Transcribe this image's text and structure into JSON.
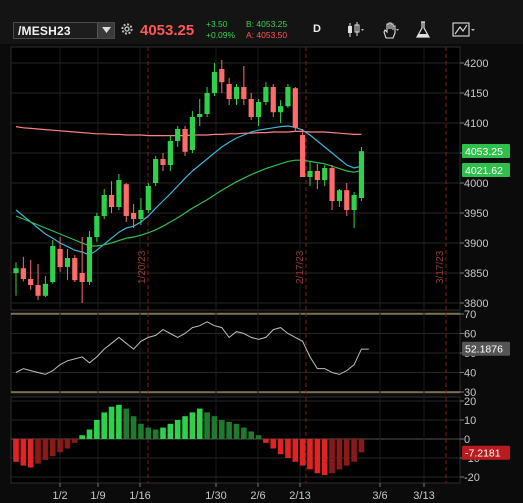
{
  "toolbar": {
    "symbol": "/MESH23",
    "last_price": "4053.25",
    "net_change": "+3.50",
    "pct_change": "+0.09%",
    "bid": "B: 4053.25",
    "ask": "A: 4053.50",
    "aggregation": "D",
    "icons": [
      "gear-icon",
      "candles-icon",
      "hand-icon",
      "flask-icon",
      "drawing-tools-icon"
    ]
  },
  "chart_data": [
    {
      "type": "candlestick",
      "ylim": [
        3790,
        4205
      ],
      "y_ticks": [
        "4200",
        "4150",
        "4100",
        "4050",
        "4000",
        "3950",
        "3900",
        "3850",
        "3800"
      ],
      "x_ticks": [
        "1/2",
        "1/9",
        "1/16",
        "1/30",
        "2/6",
        "2/13",
        "3/6",
        "3/13"
      ],
      "expiration_markers": [
        "1/20/23",
        "2/17/23",
        "3/17/23"
      ],
      "price_labels": [
        {
          "text": "4053.25",
          "color": "#2fbf4b"
        },
        {
          "text": "4021.62",
          "color": "#2fbf4b"
        }
      ],
      "candles": [
        [
          3850,
          3868,
          3812,
          3858
        ],
        [
          3858,
          3877,
          3836,
          3840
        ],
        [
          3840,
          3872,
          3822,
          3830
        ],
        [
          3830,
          3865,
          3805,
          3812
        ],
        [
          3812,
          3845,
          3810,
          3832
        ],
        [
          3835,
          3905,
          3832,
          3895
        ],
        [
          3890,
          3910,
          3852,
          3860
        ],
        [
          3860,
          3890,
          3838,
          3875
        ],
        [
          3875,
          3880,
          3835,
          3838
        ],
        [
          3850,
          3910,
          3800,
          3835
        ],
        [
          3835,
          3920,
          3830,
          3910
        ],
        [
          3910,
          3950,
          3902,
          3945
        ],
        [
          3945,
          3990,
          3940,
          3980
        ],
        [
          3980,
          4003,
          3950,
          3960
        ],
        [
          3960,
          4015,
          3955,
          4005
        ],
        [
          3998,
          4000,
          3935,
          3945
        ],
        [
          3950,
          3965,
          3925,
          3940
        ],
        [
          3940,
          3975,
          3930,
          3955
        ],
        [
          3955,
          4000,
          3950,
          3995
        ],
        [
          4000,
          4045,
          3995,
          4040
        ],
        [
          4040,
          4050,
          4020,
          4030
        ],
        [
          4030,
          4080,
          4020,
          4070
        ],
        [
          4070,
          4095,
          4060,
          4090
        ],
        [
          4090,
          4095,
          4045,
          4052
        ],
        [
          4055,
          4120,
          4050,
          4110
        ],
        [
          4110,
          4140,
          4095,
          4115
        ],
        [
          4115,
          4160,
          4110,
          4150
        ],
        [
          4150,
          4200,
          4145,
          4185
        ],
        [
          4190,
          4205,
          4150,
          4168
        ],
        [
          4165,
          4175,
          4130,
          4140
        ],
        [
          4140,
          4165,
          4130,
          4160
        ],
        [
          4160,
          4195,
          4130,
          4140
        ],
        [
          4140,
          4150,
          4105,
          4110
        ],
        [
          4110,
          4140,
          4095,
          4135
        ],
        [
          4135,
          4168,
          4130,
          4160
        ],
        [
          4160,
          4165,
          4110,
          4118
        ],
        [
          4118,
          4138,
          4100,
          4128
        ],
        [
          4128,
          4165,
          4125,
          4160
        ],
        [
          4158,
          4160,
          4085,
          4092
        ],
        [
          4080,
          4090,
          4010,
          4010
        ],
        [
          4010,
          4035,
          3995,
          4020
        ],
        [
          4020,
          4032,
          3990,
          4005
        ],
        [
          4005,
          4030,
          3995,
          4025
        ],
        [
          4025,
          4030,
          3955,
          3970
        ],
        [
          3970,
          3990,
          3960,
          3988
        ],
        [
          3988,
          4000,
          3945,
          3955
        ],
        [
          3955,
          3985,
          3925,
          3980
        ],
        [
          3975,
          4060,
          3970,
          4053
        ]
      ],
      "moving_averages": [
        {
          "name": "",
          "color": "#ff8080",
          "values": [
            4094,
            4092,
            4091,
            4090,
            4089,
            4088,
            4087,
            4086,
            4085,
            4084,
            4083,
            4082,
            4082,
            4081,
            4081,
            4080,
            4080,
            4080,
            4079,
            4079,
            4079,
            4079,
            4079,
            4079,
            4080,
            4080,
            4080,
            4081,
            4081,
            4082,
            4082,
            4083,
            4083,
            4084,
            4084,
            4085,
            4085,
            4085,
            4086,
            4086,
            4085,
            4085,
            4085,
            4084,
            4083,
            4082,
            4081,
            4081
          ]
        },
        {
          "name": "",
          "color": "#3fb6d8",
          "values": [
            3955,
            3945,
            3935,
            3925,
            3915,
            3908,
            3900,
            3894,
            3888,
            3885,
            3880,
            3888,
            3898,
            3908,
            3918,
            3925,
            3928,
            3935,
            3945,
            3958,
            3970,
            3982,
            3995,
            4008,
            4020,
            4030,
            4040,
            4050,
            4060,
            4068,
            4075,
            4080,
            4085,
            4088,
            4090,
            4092,
            4094,
            4095,
            4093,
            4088,
            4080,
            4070,
            4060,
            4050,
            4040,
            4030,
            4025,
            4028
          ]
        },
        {
          "name": "",
          "color": "#2fbf4b",
          "values": [
            3945,
            3940,
            3935,
            3930,
            3925,
            3920,
            3915,
            3910,
            3905,
            3900,
            3895,
            3895,
            3897,
            3900,
            3904,
            3908,
            3910,
            3913,
            3917,
            3922,
            3928,
            3935,
            3942,
            3950,
            3958,
            3965,
            3972,
            3980,
            3988,
            3995,
            4002,
            4008,
            4014,
            4019,
            4024,
            4028,
            4032,
            4036,
            4038,
            4038,
            4036,
            4034,
            4032,
            4028,
            4024,
            4020,
            4018,
            4021
          ]
        }
      ]
    },
    {
      "type": "line",
      "ylim": [
        30,
        70
      ],
      "y_ticks": [
        "70",
        "60",
        "50",
        "40",
        "30"
      ],
      "last_label": "52.1876",
      "values": [
        40,
        42,
        41,
        40,
        39,
        41,
        44,
        46,
        47,
        48,
        45,
        48,
        52,
        55,
        58,
        55,
        52,
        56,
        58,
        59,
        62,
        60,
        58,
        60,
        63,
        64,
        66,
        64,
        63,
        58,
        61,
        60,
        58,
        57,
        58,
        62,
        63,
        60,
        58,
        56,
        48,
        42,
        42,
        40,
        39,
        41,
        44,
        52,
        52
      ]
    },
    {
      "type": "bar",
      "ylim": [
        -20,
        20
      ],
      "y_ticks": [
        "20",
        "10",
        "0",
        "-10",
        "-20"
      ],
      "last_label": "-7.2181",
      "values": [
        -12,
        -14,
        -15,
        -13,
        -11,
        -9,
        -7,
        -5,
        -2,
        2,
        5,
        10,
        14,
        17,
        18,
        16,
        12,
        8,
        6,
        5,
        6,
        8,
        10,
        12,
        14,
        16,
        14,
        12,
        10,
        9,
        8,
        6,
        4,
        2,
        -2,
        -5,
        -8,
        -10,
        -12,
        -14,
        -16,
        -18,
        -19,
        -18,
        -16,
        -14,
        -12,
        -7
      ]
    }
  ]
}
